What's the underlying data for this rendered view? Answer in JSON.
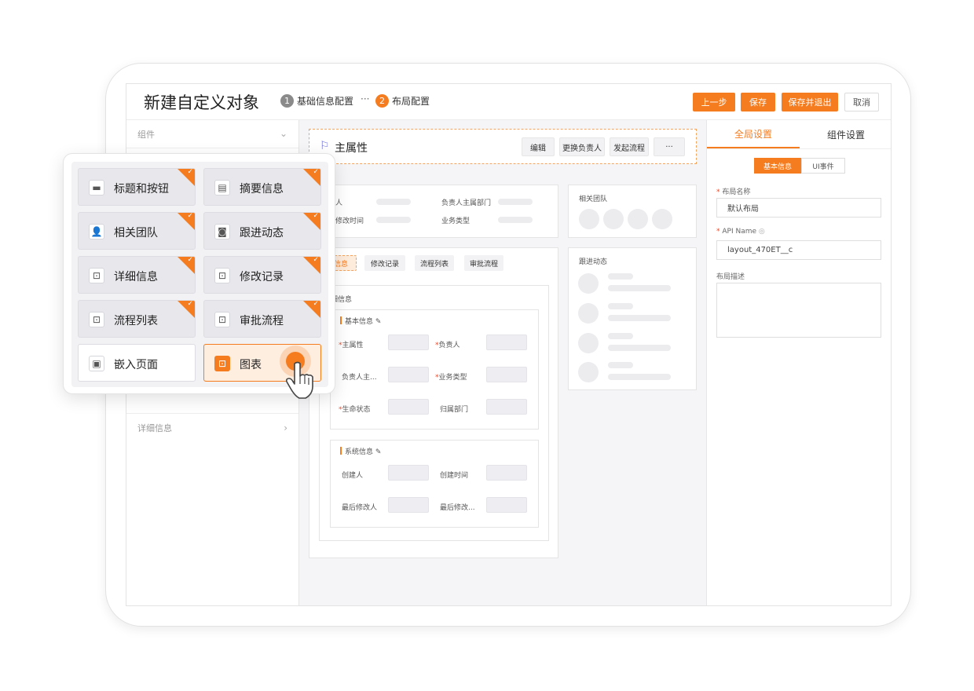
{
  "header": {
    "title": "新建自定义对象",
    "steps": [
      {
        "num": "1",
        "label": "基础信息配置"
      },
      {
        "num": "2",
        "label": "布局配置"
      }
    ],
    "step_separator": "···",
    "buttons": {
      "prev": "上一步",
      "save": "保存",
      "save_exit": "保存并退出",
      "cancel": "取消"
    }
  },
  "left_panel": {
    "section_label": "组件",
    "detail_label": "详细信息"
  },
  "canvas": {
    "attr_title": "主属性",
    "attr_buttons": [
      "编辑",
      "更换负责人",
      "发起流程",
      "···"
    ],
    "summary": {
      "labels": [
        "人",
        "负责人主属部门",
        "修改时间",
        "业务类型"
      ]
    },
    "tabs": [
      "信息",
      "修改记录",
      "流程列表",
      "审批流程"
    ],
    "detail_title": "细信息",
    "basic": {
      "title": "基本信息",
      "fields": [
        "主属性",
        "负责人",
        "负责人主...",
        "业务类型",
        "生命状态",
        "归属部门"
      ],
      "required": [
        true,
        true,
        false,
        true,
        true,
        false
      ]
    },
    "system": {
      "title": "系统信息",
      "fields": [
        "创建人",
        "创建时间",
        "最后修改人",
        "最后修改..."
      ]
    },
    "team_title": "相关团队",
    "follow_title": "跟进动态"
  },
  "right_panel": {
    "tabs": [
      "全局设置",
      "组件设置"
    ],
    "segments": [
      "基本信息",
      "UI事件"
    ],
    "layout_name_label": "布局名称",
    "layout_name_value": "默认布局",
    "api_label": "API Name",
    "api_value": "layout_470ET__c",
    "desc_label": "布局描述"
  },
  "palette": {
    "items": [
      {
        "label": "标题和按钮",
        "icon": "title-icon",
        "glyph": "▬",
        "checked": true
      },
      {
        "label": "摘要信息",
        "icon": "summary-icon",
        "glyph": "▤",
        "checked": true
      },
      {
        "label": "相关团队",
        "icon": "team-icon",
        "glyph": "👤",
        "checked": true
      },
      {
        "label": "跟进动态",
        "icon": "follow-icon",
        "glyph": "◙",
        "checked": true
      },
      {
        "label": "详细信息",
        "icon": "detail-icon",
        "glyph": "⊡",
        "checked": true
      },
      {
        "label": "修改记录",
        "icon": "record-icon",
        "glyph": "⊡",
        "checked": true
      },
      {
        "label": "流程列表",
        "icon": "process-icon",
        "glyph": "⊡",
        "checked": true
      },
      {
        "label": "审批流程",
        "icon": "approval-icon",
        "glyph": "⊡",
        "checked": true
      },
      {
        "label": "嵌入页面",
        "icon": "embed-icon",
        "glyph": "▣",
        "checked": false
      },
      {
        "label": "图表",
        "icon": "chart-icon",
        "glyph": "⊡",
        "checked": false,
        "selected": true
      }
    ]
  },
  "colors": {
    "accent": "#f57c1f",
    "flag": "#6a6ad8",
    "required": "#f04a2c"
  }
}
